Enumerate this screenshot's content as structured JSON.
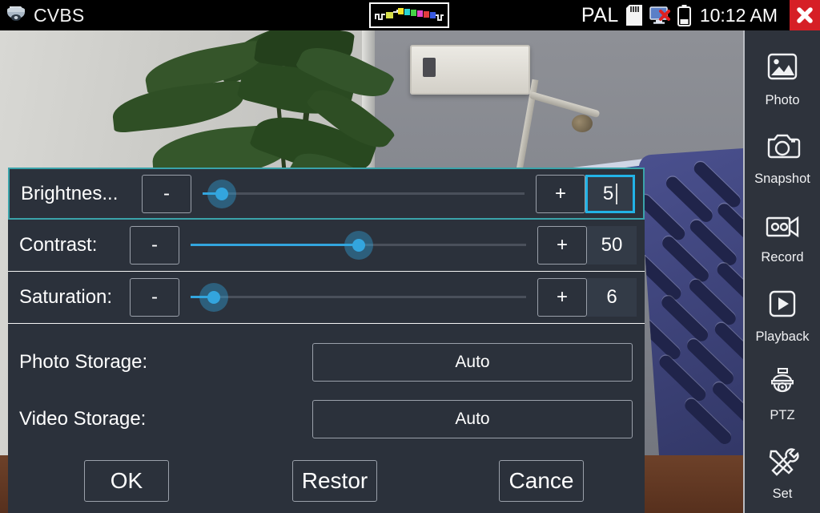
{
  "titlebar": {
    "app_title": "CVBS",
    "app_icon": "dome-camera-icon",
    "center_logo_icon": "color-bar-waveform-icon",
    "video_standard": "PAL",
    "sd_card_icon": "sd-card-icon",
    "network_icon": "monitor-disconnected-icon",
    "battery_icon": "battery-icon",
    "clock": "10:12 AM",
    "close_icon": "close-x-icon"
  },
  "sidebar": {
    "items": [
      {
        "label": "Photo",
        "icon": "photo-icon"
      },
      {
        "label": "Snapshot",
        "icon": "camera-icon"
      },
      {
        "label": "Record",
        "icon": "video-camera-icon"
      },
      {
        "label": "Playback",
        "icon": "play-icon"
      },
      {
        "label": "PTZ",
        "icon": "dome-camera-icon"
      },
      {
        "label": "Set",
        "icon": "tools-icon"
      }
    ]
  },
  "dialog": {
    "sliders": [
      {
        "label": "Brightnes...",
        "minus": "-",
        "plus": "+",
        "value": "5",
        "percent": 6,
        "focused": true
      },
      {
        "label": "Contrast:",
        "minus": "-",
        "plus": "+",
        "value": "50",
        "percent": 50,
        "focused": false
      },
      {
        "label": "Saturation:",
        "minus": "-",
        "plus": "+",
        "value": "6",
        "percent": 7,
        "focused": false
      }
    ],
    "choices": [
      {
        "label": "Photo Storage:",
        "value": "Auto"
      },
      {
        "label": "Video Storage:",
        "value": "Auto"
      }
    ],
    "buttons": {
      "ok": "OK",
      "restore": "Restor",
      "cancel": "Cance"
    }
  },
  "colors": {
    "accent_cyan": "#22b3e6",
    "slider_blue": "#33a5de",
    "focus_border": "#3aa3aa",
    "dialog_bg": "#2b313b",
    "sidebar_bg": "#2e333c",
    "close_red": "#d61f26"
  }
}
